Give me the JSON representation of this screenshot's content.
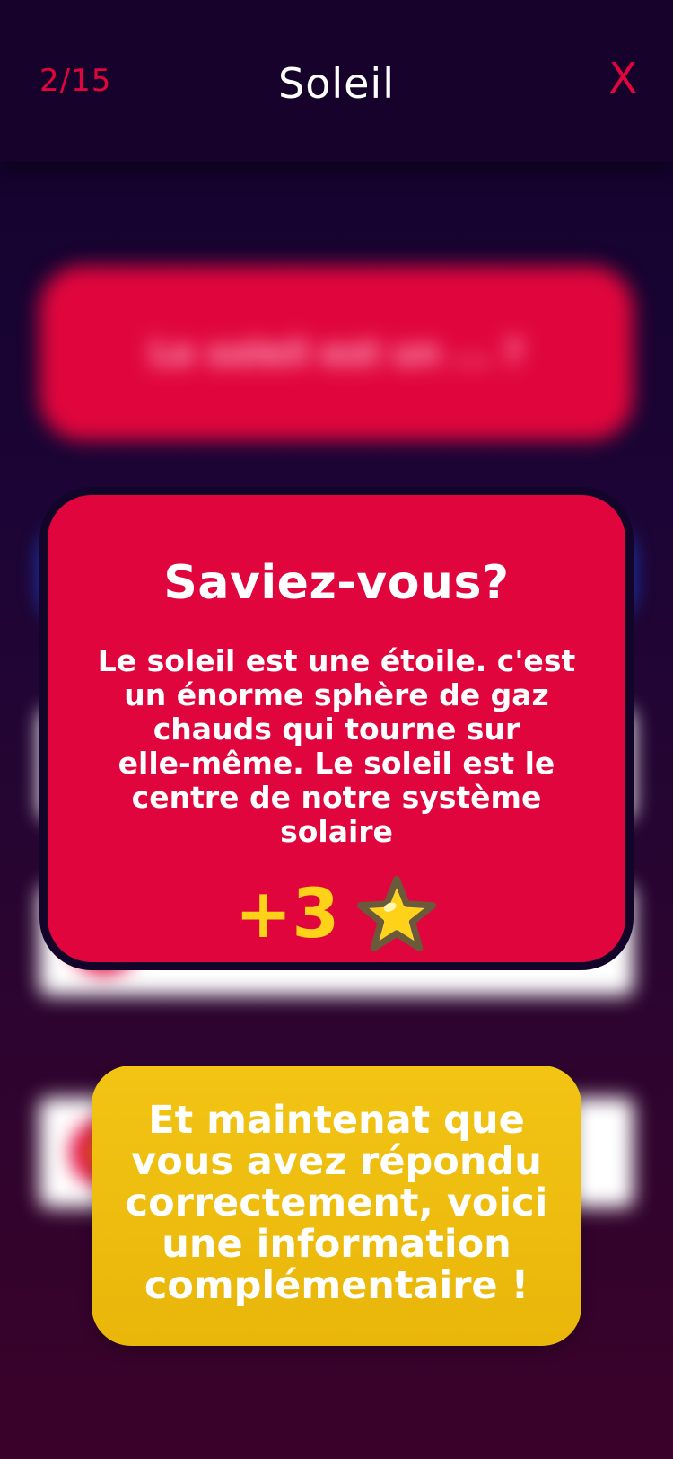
{
  "header": {
    "progress": "2/15",
    "title": "Soleil",
    "close_label": "X"
  },
  "background": {
    "question": "Le soleil est un ... ?"
  },
  "info": {
    "title": "Saviez-vous?",
    "lines": [
      "Le soleil est une étoile. c'est",
      "un énorme sphère de gaz",
      "chauds qui tourne sur",
      "elle-même. Le soleil est le",
      "centre de notre système",
      "solaire"
    ],
    "reward": "+3",
    "reward_icon": "star-icon"
  },
  "message": {
    "lines": [
      "Et maintenat que",
      "vous avez répondu",
      "correctement, voici",
      "une information",
      "complémentaire !"
    ]
  },
  "colors": {
    "accent_red": "#e0063d",
    "header_bg": "#16022b",
    "reward_yellow": "#ffd21a",
    "message_yellow": "#f2c414"
  }
}
